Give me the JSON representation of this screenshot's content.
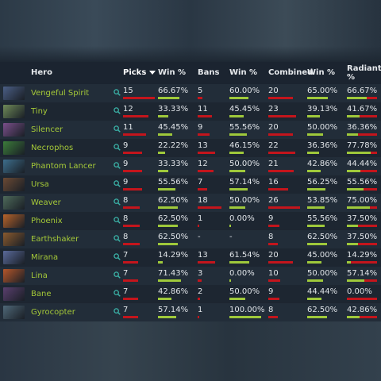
{
  "columns": {
    "hero": "Hero",
    "picks": "Picks",
    "pick_win": "Win %",
    "bans": "Bans",
    "ban_win": "Win %",
    "combined": "Combined",
    "combined_win": "Win %",
    "radiant": "Radiant",
    "radiant_pct": "%"
  },
  "colors": {
    "hero_name": "#a5c938",
    "bar_red": "#c4151c",
    "bar_green": "#9fc93b",
    "search_icon": "#3bb3a8"
  },
  "rows": [
    {
      "hero": "Vengeful Spirit",
      "avatar": "#4b5f86",
      "picks": "15",
      "picks_frac": 1.0,
      "pick_win": "66.67%",
      "pick_win_frac": 0.6667,
      "bans": "5",
      "bans_frac": 0.19,
      "ban_win": "60.00%",
      "ban_win_frac": 0.6,
      "combined": "20",
      "combined_frac": 0.77,
      "combined_win": "65.00%",
      "combined_win_frac": 0.65,
      "radiant": "66.67%",
      "radiant_frac": 0.6667
    },
    {
      "hero": "Tiny",
      "avatar": "#6f8a58",
      "picks": "12",
      "picks_frac": 0.8,
      "pick_win": "33.33%",
      "pick_win_frac": 0.3333,
      "bans": "11",
      "bans_frac": 0.61,
      "ban_win": "45.45%",
      "ban_win_frac": 0.4545,
      "combined": "23",
      "combined_frac": 0.88,
      "combined_win": "39.13%",
      "combined_win_frac": 0.3913,
      "radiant": "41.67%",
      "radiant_frac": 0.4167
    },
    {
      "hero": "Silencer",
      "avatar": "#7a4f8a",
      "picks": "11",
      "picks_frac": 0.73,
      "pick_win": "45.45%",
      "pick_win_frac": 0.4545,
      "bans": "9",
      "bans_frac": 0.5,
      "ban_win": "55.56%",
      "ban_win_frac": 0.5556,
      "combined": "20",
      "combined_frac": 0.77,
      "combined_win": "50.00%",
      "combined_win_frac": 0.5,
      "radiant": "36.36%",
      "radiant_frac": 0.3636
    },
    {
      "hero": "Necrophos",
      "avatar": "#3c7c3a",
      "picks": "9",
      "picks_frac": 0.6,
      "pick_win": "22.22%",
      "pick_win_frac": 0.2222,
      "bans": "13",
      "bans_frac": 0.72,
      "ban_win": "46.15%",
      "ban_win_frac": 0.4615,
      "combined": "22",
      "combined_frac": 0.85,
      "combined_win": "36.36%",
      "combined_win_frac": 0.3636,
      "radiant": "77.78%",
      "radiant_frac": 0.7778
    },
    {
      "hero": "Phantom Lancer",
      "avatar": "#3d6e8c",
      "picks": "9",
      "picks_frac": 0.6,
      "pick_win": "33.33%",
      "pick_win_frac": 0.3333,
      "bans": "12",
      "bans_frac": 0.67,
      "ban_win": "50.00%",
      "ban_win_frac": 0.5,
      "combined": "21",
      "combined_frac": 0.81,
      "combined_win": "42.86%",
      "combined_win_frac": 0.4286,
      "radiant": "44.44%",
      "radiant_frac": 0.4444
    },
    {
      "hero": "Ursa",
      "avatar": "#6b4a34",
      "picks": "9",
      "picks_frac": 0.6,
      "pick_win": "55.56%",
      "pick_win_frac": 0.5556,
      "bans": "7",
      "bans_frac": 0.39,
      "ban_win": "57.14%",
      "ban_win_frac": 0.5714,
      "combined": "16",
      "combined_frac": 0.62,
      "combined_win": "56.25%",
      "combined_win_frac": 0.5625,
      "radiant": "55.56%",
      "radiant_frac": 0.5556
    },
    {
      "hero": "Weaver",
      "avatar": "#4e6a5a",
      "picks": "8",
      "picks_frac": 0.53,
      "pick_win": "62.50%",
      "pick_win_frac": 0.625,
      "bans": "18",
      "bans_frac": 1.0,
      "ban_win": "50.00%",
      "ban_win_frac": 0.5,
      "combined": "26",
      "combined_frac": 1.0,
      "combined_win": "53.85%",
      "combined_win_frac": 0.5385,
      "radiant": "75.00%",
      "radiant_frac": 0.75
    },
    {
      "hero": "Phoenix",
      "avatar": "#b8632a",
      "picks": "8",
      "picks_frac": 0.53,
      "pick_win": "62.50%",
      "pick_win_frac": 0.625,
      "bans": "1",
      "bans_frac": 0.06,
      "ban_win": "0.00%",
      "ban_win_frac": 0.0,
      "combined": "9",
      "combined_frac": 0.35,
      "combined_win": "55.56%",
      "combined_win_frac": 0.5556,
      "radiant": "37.50%",
      "radiant_frac": 0.375
    },
    {
      "hero": "Earthshaker",
      "avatar": "#8a5a2e",
      "picks": "8",
      "picks_frac": 0.53,
      "pick_win": "62.50%",
      "pick_win_frac": 0.625,
      "bans": "-",
      "bans_frac": 0,
      "ban_win": "-",
      "ban_win_frac": -1,
      "combined": "8",
      "combined_frac": 0.31,
      "combined_win": "62.50%",
      "combined_win_frac": 0.625,
      "radiant": "37.50%",
      "radiant_frac": 0.375
    },
    {
      "hero": "Mirana",
      "avatar": "#5a6a9a",
      "picks": "7",
      "picks_frac": 0.47,
      "pick_win": "14.29%",
      "pick_win_frac": 0.1429,
      "bans": "13",
      "bans_frac": 0.72,
      "ban_win": "61.54%",
      "ban_win_frac": 0.6154,
      "combined": "20",
      "combined_frac": 0.77,
      "combined_win": "45.00%",
      "combined_win_frac": 0.45,
      "radiant": "14.29%",
      "radiant_frac": 0.1429
    },
    {
      "hero": "Lina",
      "avatar": "#b5562a",
      "picks": "7",
      "picks_frac": 0.47,
      "pick_win": "71.43%",
      "pick_win_frac": 0.7143,
      "bans": "3",
      "bans_frac": 0.17,
      "ban_win": "0.00%",
      "ban_win_frac": 0.0,
      "combined": "10",
      "combined_frac": 0.38,
      "combined_win": "50.00%",
      "combined_win_frac": 0.5,
      "radiant": "57.14%",
      "radiant_frac": 0.5714
    },
    {
      "hero": "Bane",
      "avatar": "#5a3f6e",
      "picks": "7",
      "picks_frac": 0.47,
      "pick_win": "42.86%",
      "pick_win_frac": 0.4286,
      "bans": "2",
      "bans_frac": 0.11,
      "ban_win": "50.00%",
      "ban_win_frac": 0.5,
      "combined": "9",
      "combined_frac": 0.35,
      "combined_win": "44.44%",
      "combined_win_frac": 0.4444,
      "radiant": "0.00%",
      "radiant_frac": 0.0
    },
    {
      "hero": "Gyrocopter",
      "avatar": "#4f6878",
      "picks": "7",
      "picks_frac": 0.47,
      "pick_win": "57.14%",
      "pick_win_frac": 0.5714,
      "bans": "1",
      "bans_frac": 0.06,
      "ban_win": "100.00%",
      "ban_win_frac": 1.0,
      "combined": "8",
      "combined_frac": 0.31,
      "combined_win": "62.50%",
      "combined_win_frac": 0.625,
      "radiant": "42.86%",
      "radiant_frac": 0.4286
    }
  ]
}
